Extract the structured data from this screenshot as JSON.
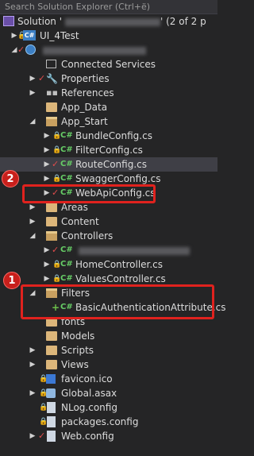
{
  "search": {
    "text": "Search Solution Explorer (Ctrl+ë)"
  },
  "solution": {
    "prefix": "Solution '",
    "suffix": "' (2 of 2 p"
  },
  "projects": [
    {
      "label": "UI_4Test"
    }
  ],
  "tree": [
    {
      "label": "Connected Services"
    },
    {
      "label": "Properties"
    },
    {
      "label": "References"
    },
    {
      "label": "App_Data"
    },
    {
      "label": "App_Start"
    },
    {
      "label": "BundleConfig.cs"
    },
    {
      "label": "FilterConfig.cs"
    },
    {
      "label": "RouteConfig.cs"
    },
    {
      "label": "SwaggerConfig.cs"
    },
    {
      "label": "WebApiConfig.cs"
    },
    {
      "label": "Areas"
    },
    {
      "label": "Content"
    },
    {
      "label": "Controllers"
    },
    {
      "label": ""
    },
    {
      "label": "HomeController.cs"
    },
    {
      "label": "ValuesController.cs"
    },
    {
      "label": "Filters"
    },
    {
      "label": "BasicAuthenticationAttribute.cs"
    },
    {
      "label": "fonts"
    },
    {
      "label": "Models"
    },
    {
      "label": "Scripts"
    },
    {
      "label": "Views"
    },
    {
      "label": "favicon.ico"
    },
    {
      "label": "Global.asax"
    },
    {
      "label": "NLog.config"
    },
    {
      "label": "packages.config"
    },
    {
      "label": "Web.config"
    }
  ],
  "badges": {
    "one": "1",
    "two": "2"
  },
  "colors": {
    "highlight": "#e0221e",
    "background": "#252526",
    "selected": "#3f3f46"
  }
}
